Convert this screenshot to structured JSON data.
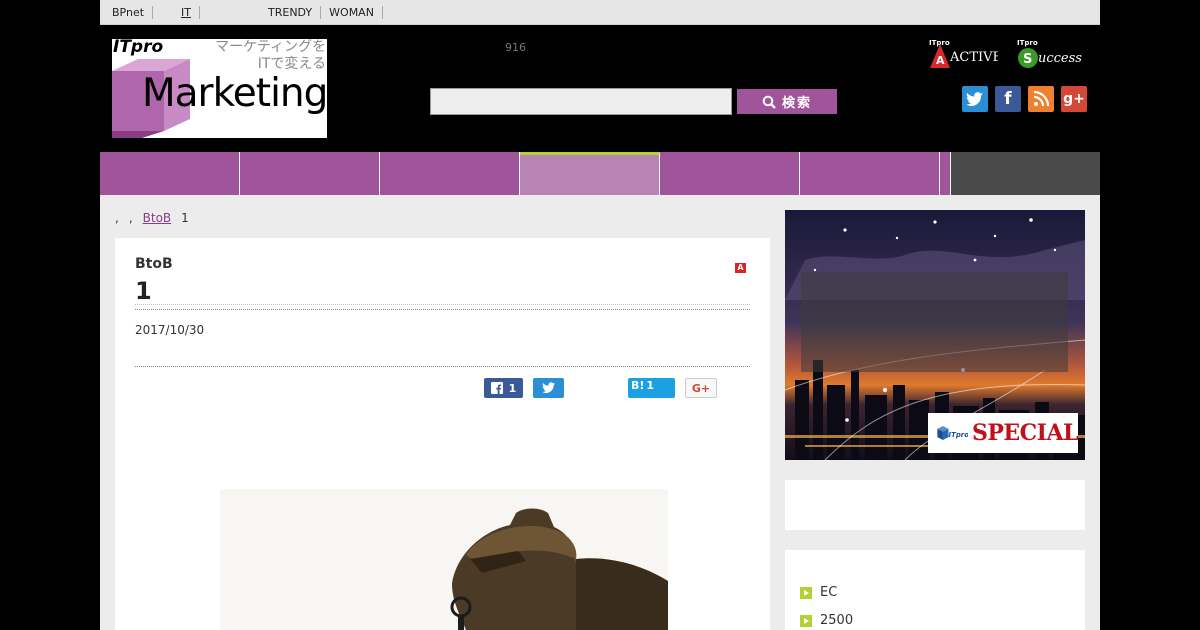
{
  "topnav": {
    "items": [
      "BPnet",
      "",
      "IT",
      "",
      "",
      "",
      "TRENDY",
      "WOMAN",
      "",
      "",
      ""
    ]
  },
  "header": {
    "logo": {
      "brand": "ITpro",
      "tagline_line1": "マーケティングを",
      "tagline_line2": "ITで変える",
      "word": "Marketing"
    },
    "counter": "916",
    "search": {
      "placeholder": "",
      "button_label": "検索"
    },
    "badges": {
      "active": "ACTIVE",
      "success": "Success"
    },
    "social": [
      "twitter-icon",
      "facebook-icon",
      "rss-icon",
      "google-plus-icon"
    ]
  },
  "catnav": {
    "items": [
      "",
      "",
      "",
      "",
      "",
      "",
      ""
    ],
    "active_index": 3
  },
  "breadcrumb": {
    "items": [
      ",",
      ",",
      "BtoB",
      "1"
    ]
  },
  "article": {
    "category": "BtoB",
    "title": "1",
    "date": "2017/10/30",
    "share": {
      "facebook_count": "1",
      "hatena_label": "B!",
      "hatena_count": "1",
      "gplus_label": "G+"
    }
  },
  "sidebar": {
    "promo": {
      "brand": "ITpro",
      "label": "SPECIAL"
    },
    "list": [
      "EC",
      "2500"
    ]
  },
  "colors": {
    "brand_purple": "#a0559a",
    "accent_green": "#b2d234",
    "nav_dark": "#4a4a4a"
  }
}
